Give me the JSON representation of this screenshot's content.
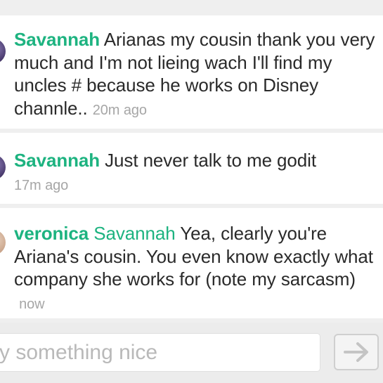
{
  "comments": [
    {
      "author": "Savannah",
      "text": "Arianas my cousin thank you very much and I'm not lieing wach I'll find my uncles # because he works on Disney channle..",
      "time": "20m ago"
    },
    {
      "author": "Savannah",
      "text": "Just never talk to me godit",
      "time": "17m ago"
    },
    {
      "author": "veronica",
      "mention": "Savannah",
      "text": "Yea, clearly you're Ariana's cousin. You even know exactly what company she works for (note my sarcasm)",
      "time": "now"
    }
  ],
  "compose": {
    "placeholder": "y something nice",
    "send_icon": "arrow-right-icon"
  },
  "colors": {
    "author": "#1db380",
    "timestamp": "#a6a6a6",
    "text": "#2a2a2a",
    "background": "#efefef"
  }
}
